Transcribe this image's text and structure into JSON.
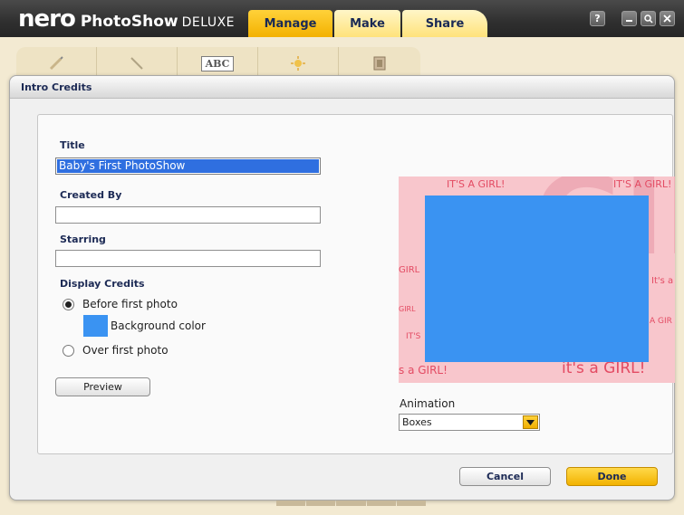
{
  "app": {
    "logo_nero": "nero",
    "logo_product": "PhotoShow",
    "logo_edition": "DELUXE",
    "tabs": [
      {
        "label": "Manage",
        "active": true
      },
      {
        "label": "Make",
        "active": false
      },
      {
        "label": "Share",
        "active": false
      }
    ],
    "window_buttons": [
      "help-icon",
      "minimize-icon",
      "restore-icon",
      "close-icon"
    ],
    "help_label": "?"
  },
  "toolbar": {
    "tools": [
      "pencil-icon",
      "line-icon",
      "abc-text-icon",
      "sparkle-icon",
      "film-icon"
    ],
    "abc_label": "ABC"
  },
  "dialog": {
    "title": "Intro Credits",
    "title_label": "Title",
    "title_value": "Baby's First PhotoShow",
    "created_by_label": "Created By",
    "created_by_value": "",
    "starring_label": "Starring",
    "starring_value": "",
    "display_credits_label": "Display Credits",
    "options": [
      {
        "label": "Before first photo",
        "selected": true
      },
      {
        "label": "Over first photo",
        "selected": false
      }
    ],
    "background_color_label": "Background color",
    "background_color": "#3a93f2",
    "preview_button": "Preview",
    "animation_label": "Animation",
    "animation_value": "Boxes",
    "cancel_button": "Cancel",
    "done_button": "Done"
  },
  "preview_image": {
    "texts": [
      "IT'S A GIRL!",
      "IT'S A GIRL!",
      "GIRL",
      "It's a",
      "GIRL",
      "A GIR",
      "IT'S",
      "s a GIRL!",
      "it's a GIRL!"
    ]
  },
  "colors": {
    "accent": "#f3b100",
    "titlebar": "#2f2f2f",
    "selection": "#2f6fe0",
    "preview_bg": "#f8c6cc"
  }
}
